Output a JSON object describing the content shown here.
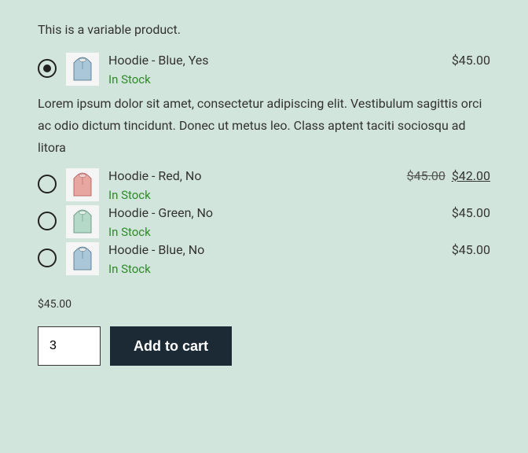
{
  "intro": "This is a variable product.",
  "description": "Lorem ipsum dolor sit amet, consectetur adipiscing elit. Vestibulum sagittis orci ac odio dictum tincidunt. Donec ut metus leo. Class aptent taciti sociosqu ad litora",
  "variants": [
    {
      "name": "Hoodie - Blue, Yes",
      "price": "$45.00",
      "stock": "In Stock",
      "selected": true,
      "color": "#a9c7d9"
    },
    {
      "name": "Hoodie - Red, No",
      "price_old": "$45.00",
      "price": "$42.00",
      "sale": true,
      "stock": "In Stock",
      "selected": false,
      "color": "#e8a6a1"
    },
    {
      "name": "Hoodie - Green, No",
      "price": "$45.00",
      "stock": "In Stock",
      "selected": false,
      "color": "#b4d9c9"
    },
    {
      "name": "Hoodie - Blue, No",
      "price": "$45.00",
      "stock": "In Stock",
      "selected": false,
      "color": "#a9c7d9"
    }
  ],
  "footer_price": "$45.00",
  "quantity": "3",
  "add_to_cart": "Add to cart"
}
